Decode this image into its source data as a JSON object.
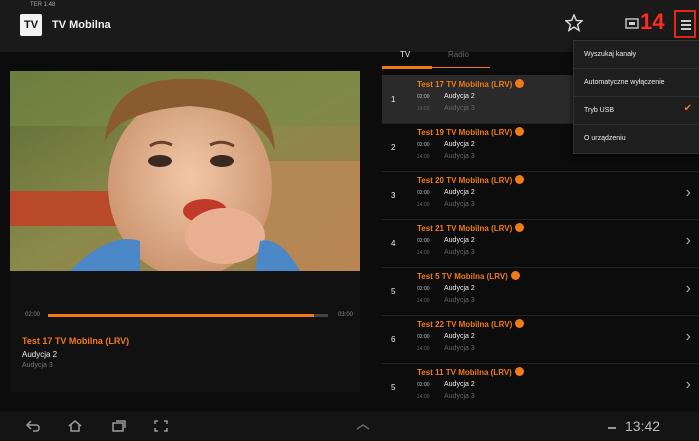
{
  "status_line": "TER 1:48",
  "app": {
    "logo_text": "TV",
    "title": "TV Mobilna"
  },
  "badge": "14",
  "tabs": [
    {
      "label": "TV",
      "active": true
    },
    {
      "label": "Radio",
      "active": false
    }
  ],
  "player": {
    "time_start": "02:00",
    "time_end": "03:00",
    "progress": 0.95,
    "title": "Test 17 TV Mobilna (LRV)",
    "program": "Audycja 2",
    "next": "Audycja 3"
  },
  "channels": [
    {
      "number": "1",
      "name": "Test 17 TV Mobilna (LRV)",
      "time1": "02:00",
      "prog1": "Audycja 2",
      "time2": "14:00",
      "prog2": "Audycja 3",
      "selected": true
    },
    {
      "number": "2",
      "name": "Test 19 TV Mobilna (LRV)",
      "time1": "02:00",
      "prog1": "Audycja 2",
      "time2": "14:00",
      "prog2": "Audycja 3",
      "selected": false
    },
    {
      "number": "3",
      "name": "Test 20 TV Mobilna (LRV)",
      "time1": "02:00",
      "prog1": "Audycja 2",
      "time2": "14:00",
      "prog2": "Audycja 3",
      "selected": false
    },
    {
      "number": "4",
      "name": "Test 21 TV Mobilna (LRV)",
      "time1": "02:00",
      "prog1": "Audycja 2",
      "time2": "14:00",
      "prog2": "Audycja 3",
      "selected": false
    },
    {
      "number": "5",
      "name": "Test 5 TV Mobilna (LRV)",
      "time1": "02:00",
      "prog1": "Audycja 2",
      "time2": "14:00",
      "prog2": "Audycja 3",
      "selected": false
    },
    {
      "number": "6",
      "name": "Test 22 TV Mobilna (LRV)",
      "time1": "02:00",
      "prog1": "Audycja 2",
      "time2": "14:00",
      "prog2": "Audycja 3",
      "selected": false
    },
    {
      "number": "5",
      "name": "Test 11 TV Mobilna (LRV)",
      "time1": "02:00",
      "prog1": "Audycja 2",
      "time2": "14:00",
      "prog2": "Audycja 3",
      "selected": false
    }
  ],
  "menu": [
    {
      "label": "Wyszukaj kanały",
      "checked": false
    },
    {
      "label": "Automatyczne wyłączenie",
      "checked": false
    },
    {
      "label": "Tryb USB",
      "checked": true
    },
    {
      "label": "O urządzeniu",
      "checked": false
    }
  ],
  "clock": "13:42",
  "colors": {
    "accent": "#f07a18",
    "highlight": "#e02a18",
    "background": "#0c0c0c"
  }
}
